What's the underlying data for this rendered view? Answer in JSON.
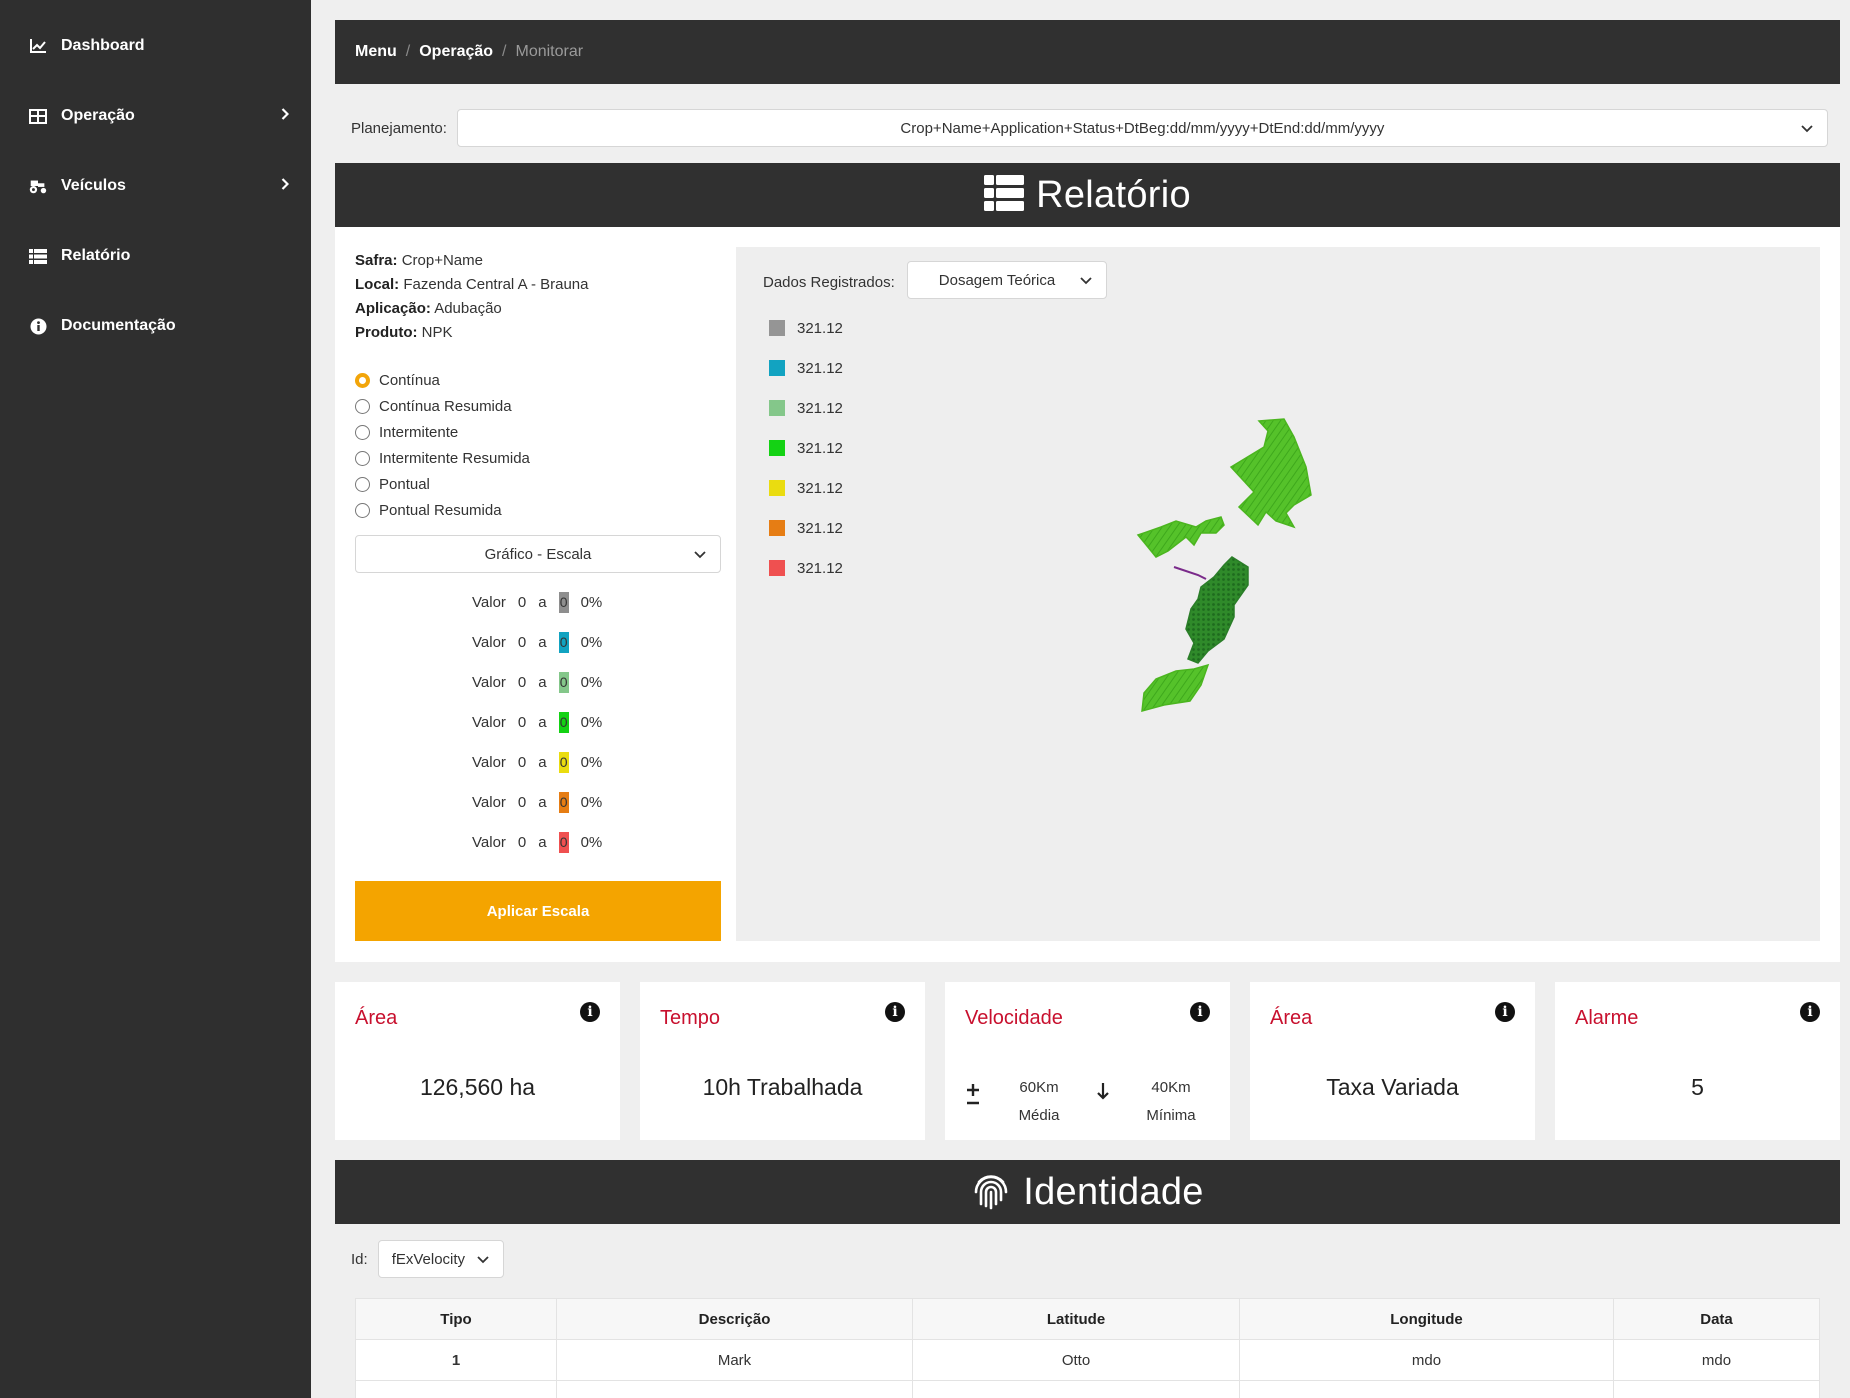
{
  "sidebar": {
    "items": [
      {
        "label": "Dashboard",
        "icon": "chart-line-icon",
        "has_submenu": false
      },
      {
        "label": "Operação",
        "icon": "table-grid-icon",
        "has_submenu": true
      },
      {
        "label": "Veículos",
        "icon": "tractor-icon",
        "has_submenu": true
      },
      {
        "label": "Relatório",
        "icon": "list-icon",
        "has_submenu": false
      },
      {
        "label": "Documentação",
        "icon": "info-icon",
        "has_submenu": false
      }
    ]
  },
  "breadcrumb": {
    "menu": "Menu",
    "operacao": "Operação",
    "current": "Monitorar",
    "separator": "/"
  },
  "planejamento": {
    "label": "Planejamento:",
    "value": "Crop+Name+Application+Status+DtBeg:dd/mm/yyyy+DtEnd:dd/mm/yyyy"
  },
  "relatorio": {
    "title": "Relatório",
    "info": [
      {
        "key": "Safra:",
        "value": "Crop+Name"
      },
      {
        "key": "Local:",
        "value": "Fazenda Central A - Brauna"
      },
      {
        "key": "Aplicação:",
        "value": "Adubação"
      },
      {
        "key": "Produto:",
        "value": "NPK"
      }
    ],
    "modes": [
      "Contínua",
      "Contínua Resumida",
      "Intermitente",
      "Intermitente Resumida",
      "Pontual",
      "Pontual Resumida"
    ],
    "selected_mode": "Contínua",
    "chart_select": "Gráfico - Escala",
    "scale_rows": [
      {
        "label": "Valor",
        "from": "0",
        "sep": "a",
        "to": "0",
        "pct": "0%",
        "color": "#8e8e8e"
      },
      {
        "label": "Valor",
        "from": "0",
        "sep": "a",
        "to": "0",
        "pct": "0%",
        "color": "#12a3c1"
      },
      {
        "label": "Valor",
        "from": "0",
        "sep": "a",
        "to": "0",
        "pct": "0%",
        "color": "#84c78a"
      },
      {
        "label": "Valor",
        "from": "0",
        "sep": "a",
        "to": "0",
        "pct": "0%",
        "color": "#14d214"
      },
      {
        "label": "Valor",
        "from": "0",
        "sep": "a",
        "to": "0",
        "pct": "0%",
        "color": "#eadc10"
      },
      {
        "label": "Valor",
        "from": "0",
        "sep": "a",
        "to": "0",
        "pct": "0%",
        "color": "#e67d14"
      },
      {
        "label": "Valor",
        "from": "0",
        "sep": "a",
        "to": "0",
        "pct": "0%",
        "color": "#ef5050"
      }
    ],
    "apply_label": "Aplicar Escala",
    "map": {
      "dados_label": "Dados Registrados:",
      "dados_value": "Dosagem Teórica",
      "legend": [
        {
          "value": "321.12",
          "color": "#959595"
        },
        {
          "value": "321.12",
          "color": "#12a3c1"
        },
        {
          "value": "321.12",
          "color": "#84c78a"
        },
        {
          "value": "321.12",
          "color": "#14d214"
        },
        {
          "value": "321.12",
          "color": "#eadc10"
        },
        {
          "value": "321.12",
          "color": "#e67d14"
        },
        {
          "value": "321.12",
          "color": "#ef5050"
        }
      ]
    }
  },
  "cards": [
    {
      "title": "Área",
      "value": "126,560 ha"
    },
    {
      "title": "Tempo",
      "value": "10h Trabalhada"
    },
    {
      "title": "Velocidade",
      "media_value": "60Km",
      "media_label": "Média",
      "minima_value": "40Km",
      "minima_label": "Mínima"
    },
    {
      "title": "Área",
      "value": "Taxa Variada"
    },
    {
      "title": "Alarme",
      "value": "5"
    }
  ],
  "identidade": {
    "title": "Identidade",
    "id_label": "Id:",
    "id_value": "fExVelocity",
    "columns": [
      "Tipo",
      "Descrição",
      "Latitude",
      "Longitude",
      "Data"
    ],
    "rows": [
      [
        "1",
        "Mark",
        "Otto",
        "mdo",
        "mdo"
      ]
    ]
  },
  "colors": {
    "accent": "#f4a400",
    "card_title": "#c8102e",
    "dark": "#303030"
  }
}
